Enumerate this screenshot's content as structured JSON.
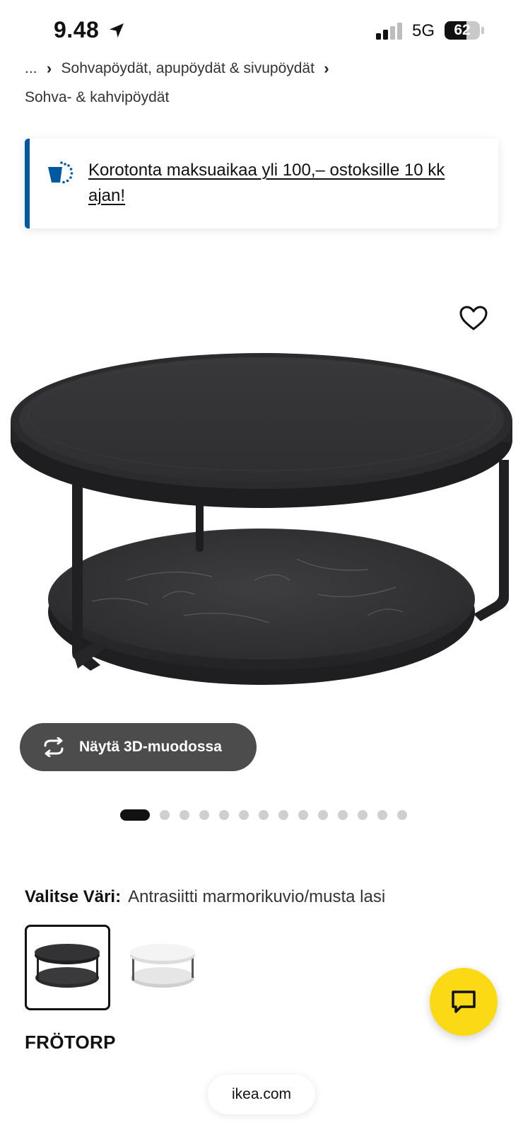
{
  "status_bar": {
    "time": "9.48",
    "network": "5G",
    "battery_percent": 62,
    "battery_label": "62",
    "signal_bars_filled": 2,
    "signal_bars_total": 4
  },
  "breadcrumb": {
    "ellipsis": "...",
    "items": [
      "Sohvapöydät, apupöydät & sivupöydät",
      "Sohva- & kahvipöydät"
    ],
    "separator": "›"
  },
  "promo": {
    "text": "Korotonta maksuaikaa yli 100,– ostoksille 10 kk ajan!",
    "accent_color": "#0058a3",
    "icon": "installment-payment-icon"
  },
  "product_image": {
    "subject": "round-coffee-table-two-tier",
    "favorite_icon": "heart-icon"
  },
  "view_3d_button": {
    "label": "Näytä 3D-muodossa",
    "icon": "rotate-3d-icon",
    "bg_color": "#4c4c4c"
  },
  "carousel": {
    "total_images": 15,
    "active_index": 0
  },
  "color_selector": {
    "label": "Valitse Väri:",
    "value": "Antrasiitti marmorikuvio/musta lasi",
    "options": [
      {
        "name": "anthracite-swatch",
        "selected": true
      },
      {
        "name": "white-swatch",
        "selected": false
      }
    ]
  },
  "product": {
    "name": "FRÖTORP"
  },
  "chat": {
    "icon": "chat-bubble-icon",
    "color": "#fbd914"
  },
  "browser": {
    "url_label": "ikea.com"
  }
}
